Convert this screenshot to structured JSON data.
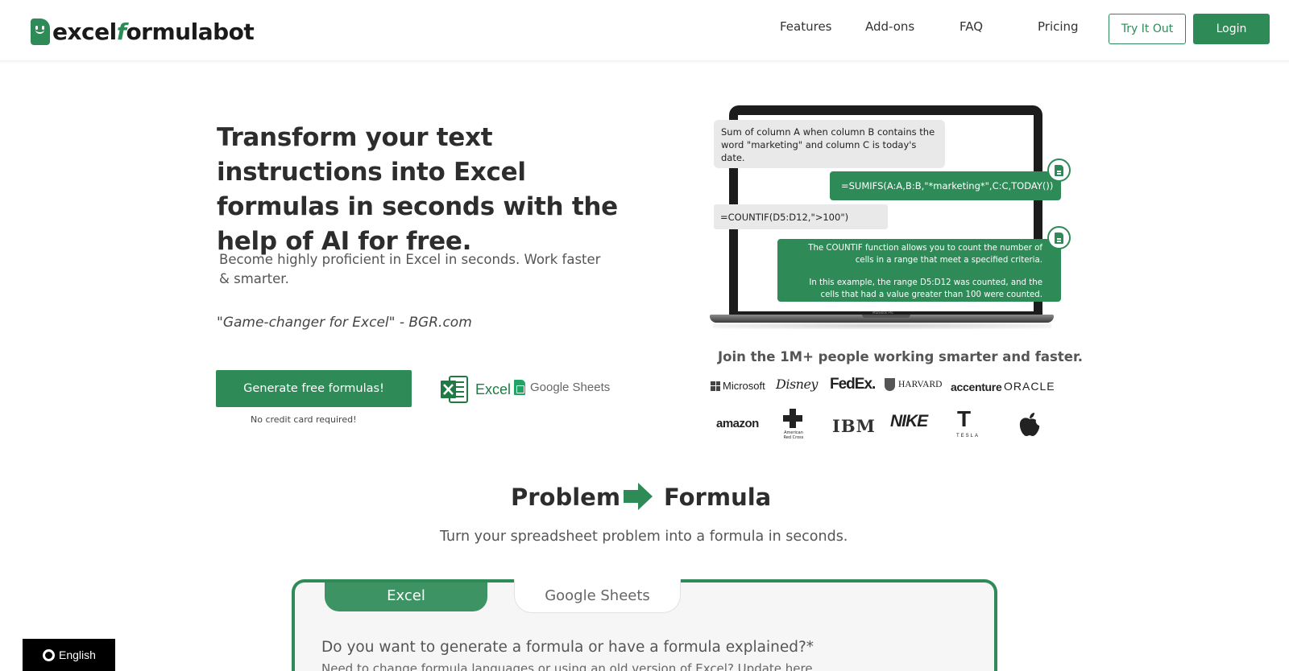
{
  "header": {
    "logo": {
      "part1": "excel",
      "part2": "f",
      "part3": "ormulabot"
    },
    "nav": [
      "Features",
      "Add-ons",
      "FAQ",
      "Pricing"
    ],
    "try_label": "Try It Out",
    "login_label": "Login"
  },
  "hero": {
    "title": "Transform your text instructions into Excel formulas in seconds with the help of AI for free.",
    "subtitle": "Become highly proficient in Excel in seconds. Work faster & smarter.",
    "quote": "\"Game-changer for Excel\" - BGR.com",
    "cta_label": "Generate free formulas!",
    "cta_note": "No credit card required!",
    "excel_label": "Excel",
    "sheets_label": "Google Sheets"
  },
  "demo": {
    "q1": "Sum of column A when column B contains the word \"marketing\" and column C is today's date.",
    "a1": "=SUMIFS(A:A,B:B,\"*marketing*\",C:C,TODAY())",
    "q2": "=COUNTIF(D5:D12,\">100\")",
    "a2_line1": "The COUNTIF function allows you to count the number of cells in a range that meet a specified criteria.",
    "a2_line2": "In this example, the range D5:D12 was counted, and the cells that had a value greater than 100 were counted.",
    "device_label": "MacBook Pro"
  },
  "social": {
    "join_text": "Join the 1M+ people working smarter and faster.",
    "brands": {
      "microsoft": "Microsoft",
      "disney": "Disney",
      "fedex": "FedEx.",
      "harvard": "HARVARD",
      "accenture": "accenture",
      "oracle": "ORACLE",
      "amazon": "amazon",
      "redcross": "American Red Cross",
      "ibm": "IBM",
      "nike": "NIKE",
      "tesla": "TESLA"
    }
  },
  "section": {
    "problem": "Problem",
    "formula": "Formula",
    "subtitle": "Turn your spreadsheet problem into a formula in seconds."
  },
  "tool": {
    "tabs": [
      "Excel",
      "Google Sheets"
    ],
    "question": "Do you want to generate a formula or have a formula explained?*",
    "note": "Need to change formula languages or using an old version of Excel? Update here"
  },
  "language": {
    "label": "English"
  },
  "colors": {
    "brand_green": "#2e8b57",
    "text_dark": "#2d2d2d",
    "lang_bg": "#000000"
  }
}
